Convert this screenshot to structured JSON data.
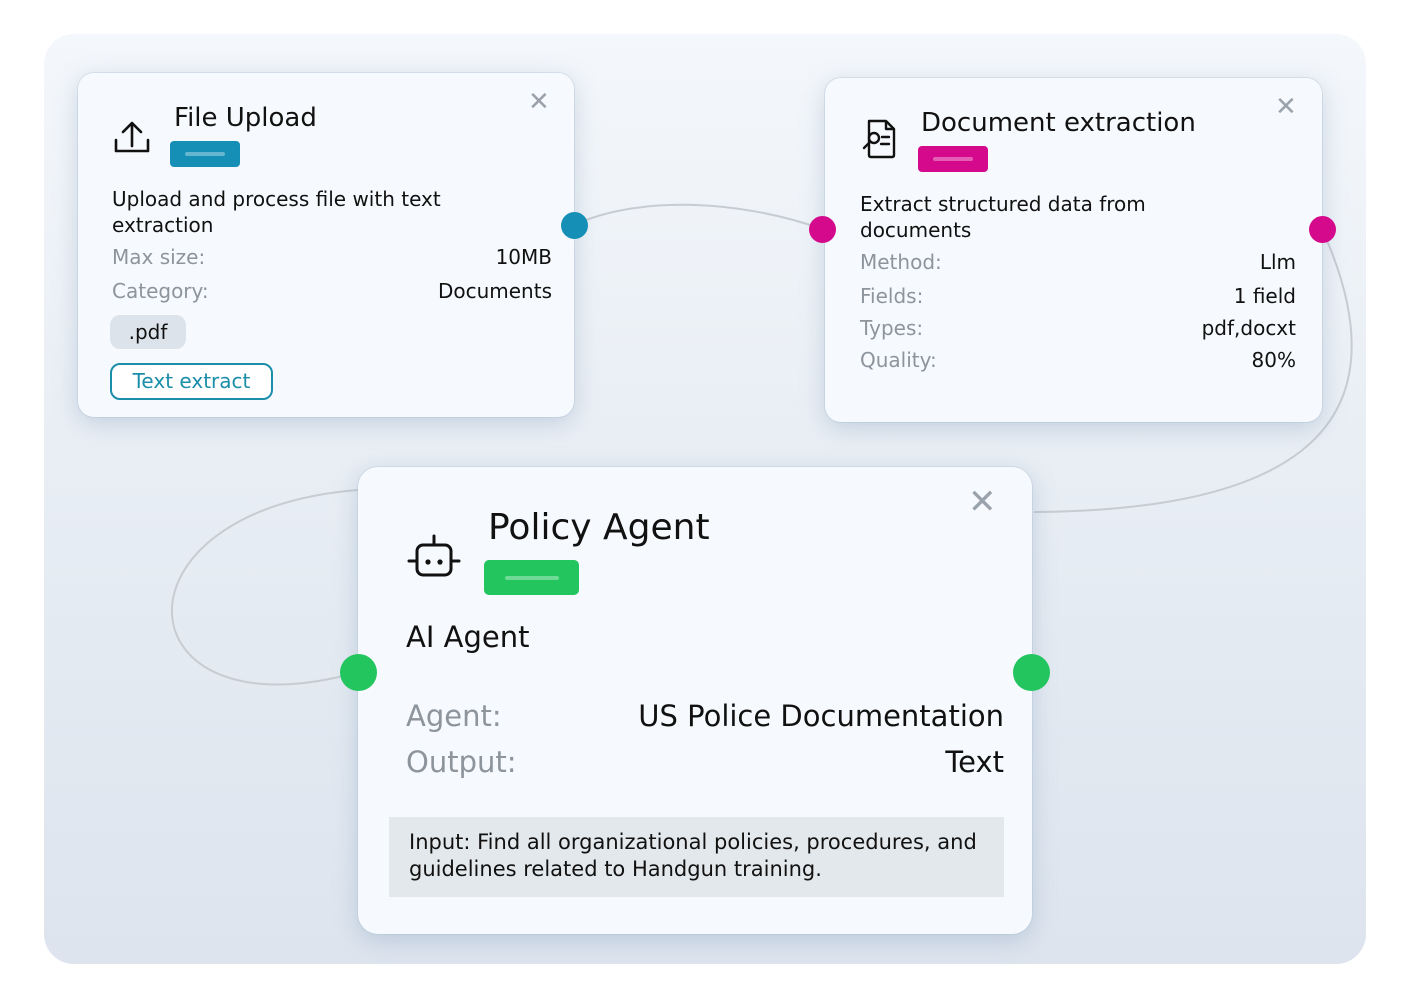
{
  "colors": {
    "upload_accent": "#158fb5",
    "extraction_accent": "#d4098c",
    "agent_accent": "#22c55e",
    "wire": "#c7ccd2"
  },
  "file_upload": {
    "icon": "upload-icon",
    "title": "File Upload",
    "description": "Upload and process file with text extraction",
    "max_size_label": "Max size:",
    "max_size_value": "10MB",
    "category_label": "Category:",
    "category_value": "Documents",
    "file_type_chip": ".pdf",
    "tag": "Text extract",
    "close": "✕"
  },
  "document_extraction": {
    "icon": "document-search-icon",
    "title": "Document extraction",
    "description": "Extract structured data from documents",
    "method_label": "Method:",
    "method_value": "Llm",
    "fields_label": "Fields:",
    "fields_value": "1 field",
    "types_label": "Types:",
    "types_value": "pdf,docxt",
    "quality_label": "Quality:",
    "quality_value": "80%",
    "close": "✕"
  },
  "policy_agent": {
    "icon": "robot-icon",
    "title": "Policy Agent",
    "subtitle": "AI Agent",
    "agent_label": "Agent:",
    "agent_value": "US Police Documentation",
    "output_label": "Output:",
    "output_value": "Text",
    "input_text": "Input: Find all organizational policies, procedures, and guidelines related to Handgun training.",
    "close": "✕"
  }
}
